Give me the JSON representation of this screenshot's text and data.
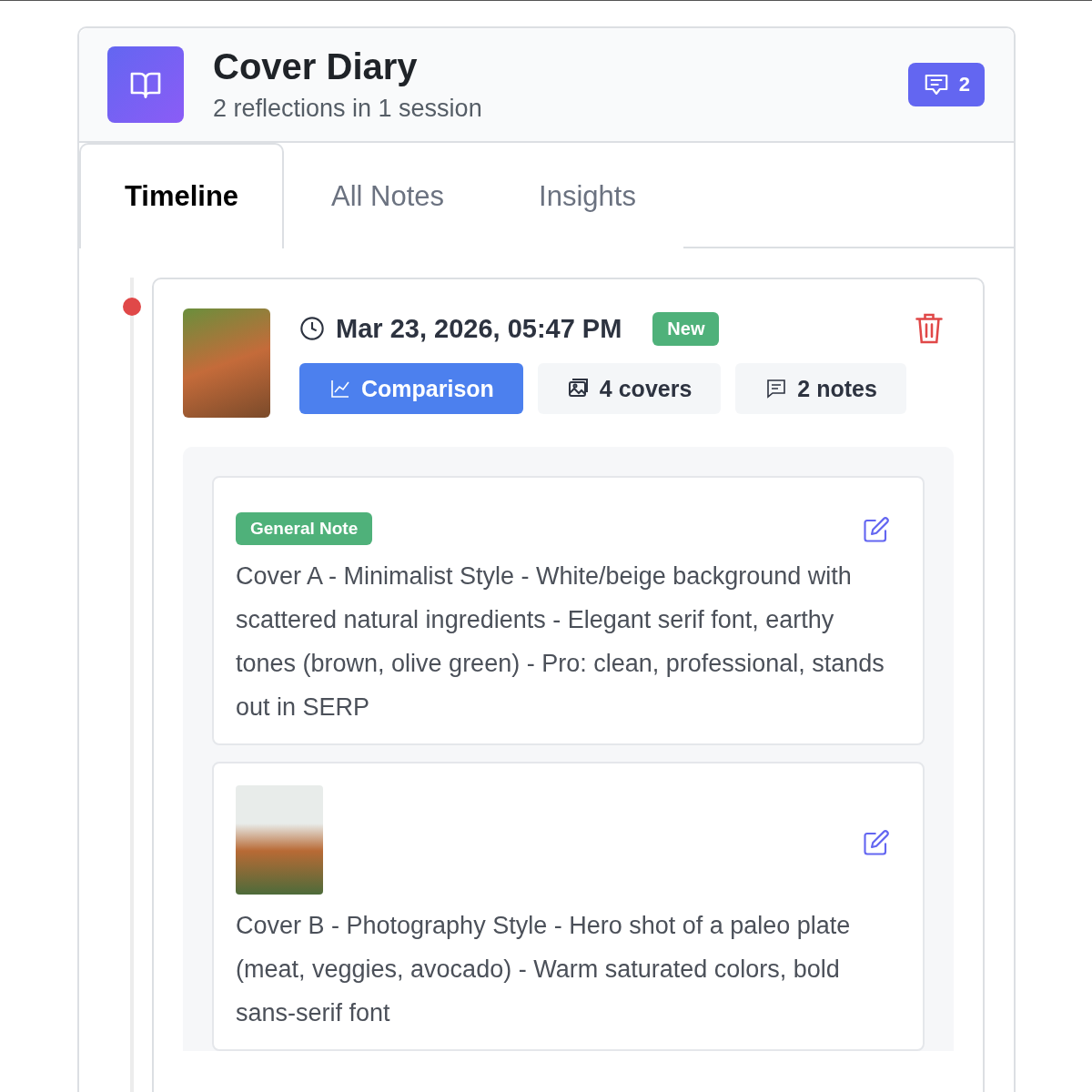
{
  "header": {
    "title": "Cover Diary",
    "subtitle": "2 reflections in 1 session",
    "badge_count": "2"
  },
  "tabs": [
    {
      "label": "Timeline",
      "selected": true
    },
    {
      "label": "All Notes",
      "selected": false
    },
    {
      "label": "Insights",
      "selected": false
    }
  ],
  "entry": {
    "timestamp": "Mar 23, 2026, 05:47 PM",
    "is_new": true,
    "new_label": "New",
    "chips": [
      {
        "kind": "comparison",
        "label": "Comparison"
      },
      {
        "kind": "covers",
        "label": "4 covers"
      },
      {
        "kind": "notes",
        "label": "2 notes"
      }
    ],
    "notes": [
      {
        "kind": "general",
        "tag": "General Note",
        "text": "Cover A - Minimalist Style - White/beige background with scattered natural ingredients - Elegant serif font, earthy tones (brown, olive green) - Pro: clean, professional, stands out in SERP"
      },
      {
        "kind": "cover",
        "text": "Cover B - Photography Style - Hero shot of a paleo plate (meat, veggies, avocado) - Warm saturated colors, bold sans-serif font"
      }
    ]
  }
}
